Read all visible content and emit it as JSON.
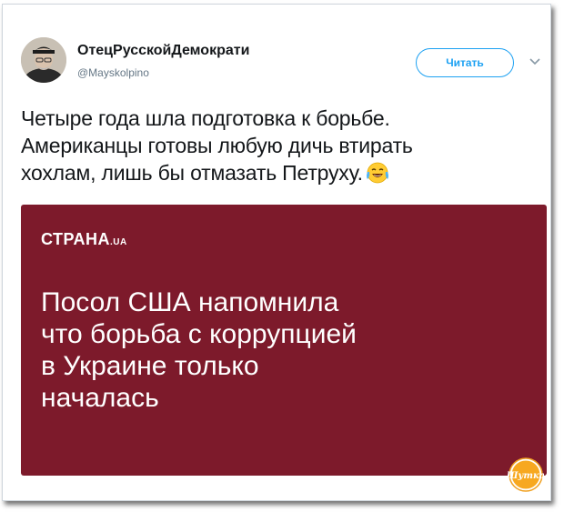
{
  "tweet": {
    "author_name": "ОтецРусскойДемократи",
    "author_handle": "@Mayskolpino",
    "follow_label": "Читать",
    "text_lines": [
      "Четыре года шла подготовка к борьбе.",
      "Американцы готовы любую дичь втирать",
      "хохлам, лишь бы отмазать Петруху."
    ],
    "emoji": "face-with-tears-of-joy"
  },
  "media": {
    "source_name": "СТРАНА",
    "source_suffix": ".UA",
    "headline_lines": [
      "Посол США напомнила",
      "что борьба с коррупцией",
      "в Украине только",
      "началась"
    ],
    "background_color": "#7d1a2b"
  },
  "watermark": {
    "text": "Шутка",
    "icon": "watermark-logo"
  },
  "colors": {
    "accent": "#1da1f2",
    "text": "#14171a",
    "muted": "#657786"
  }
}
